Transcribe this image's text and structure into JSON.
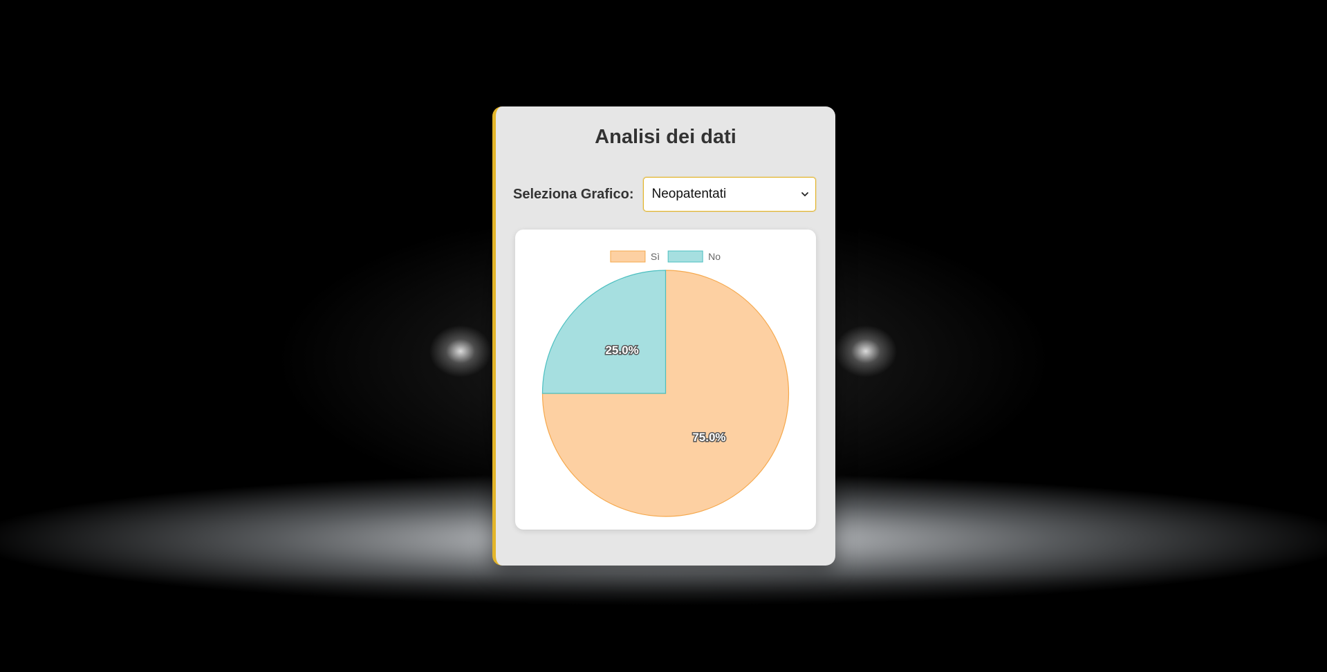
{
  "page": {
    "title": "Analisi dei dati"
  },
  "selector": {
    "label": "Seleziona Grafico:",
    "selected": "Neopatentati"
  },
  "colors": {
    "accent": "#e3b52a",
    "si_fill": "#fdd0a2",
    "si_border": "#f5a84c",
    "no_fill": "#a6dfe0",
    "no_border": "#4bbfc0"
  },
  "chart_data": {
    "type": "pie",
    "categories": [
      "Sì",
      "No"
    ],
    "values": [
      75,
      25
    ],
    "labels": [
      "75.0%",
      "25.0%"
    ],
    "legend_position": "top"
  }
}
